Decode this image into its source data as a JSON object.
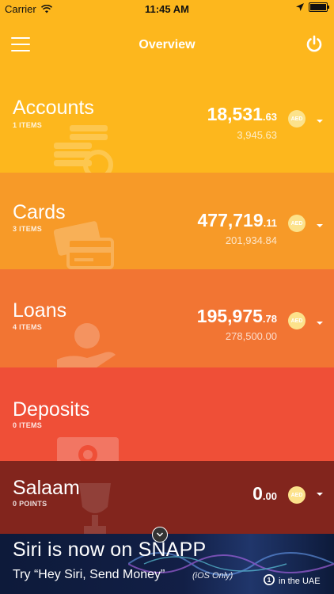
{
  "status_bar": {
    "carrier": "Carrier",
    "time": "11:45 AM",
    "wifi_icon": "wifi-icon",
    "location_icon": "location-arrow-icon",
    "battery_icon": "battery-icon"
  },
  "nav": {
    "title": "Overview",
    "menu_icon": "hamburger-icon",
    "power_icon": "power-icon"
  },
  "sections": {
    "accounts": {
      "title": "Accounts",
      "subtitle": "1 ITEMS",
      "amount_int": "18,531",
      "amount_dec": ".63",
      "secondary": "3,945.63",
      "currency": "AED",
      "icon": "coins-icon",
      "color": "#fdb71d"
    },
    "cards": {
      "title": "Cards",
      "subtitle": "3 ITEMS",
      "amount_int": "477,719",
      "amount_dec": ".11",
      "secondary": "201,934.84",
      "currency": "AED",
      "icon": "credit-card-icon",
      "color": "#f79a28"
    },
    "loans": {
      "title": "Loans",
      "subtitle": "4 ITEMS",
      "amount_int": "195,975",
      "amount_dec": ".78",
      "secondary": "278,500.00",
      "currency": "AED",
      "icon": "coin-hand-icon",
      "color": "#f27533"
    },
    "deposits": {
      "title": "Deposits",
      "subtitle": "0 ITEMS",
      "icon": "safe-icon",
      "color": "#ef4f37"
    },
    "salaam": {
      "title": "Salaam",
      "subtitle": "0  POINTS",
      "amount_int": "0",
      "amount_dec": ".00",
      "currency": "AED",
      "icon": "trophy-icon",
      "color": "#82251d"
    }
  },
  "banner": {
    "headline": "Siri is now on SNAPP",
    "tagline": "Try “Hey Siri, Send Money”",
    "note": "(iOS Only)",
    "badge_number": "1",
    "badge_text": "in the UAE",
    "background": "#0d1a3a"
  }
}
